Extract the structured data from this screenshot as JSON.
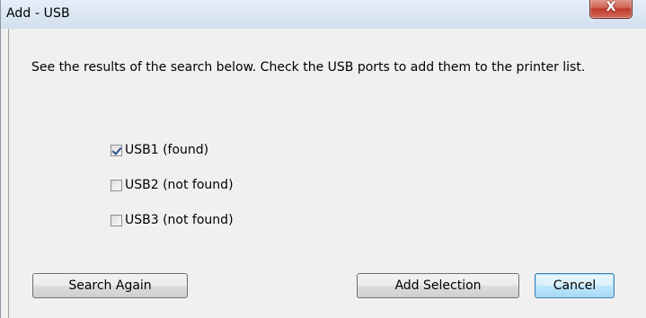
{
  "window": {
    "title": "Add  - USB",
    "close_glyph": "X"
  },
  "content": {
    "instruction": "See the results of the search below. Check the USB ports to add them to the printer list."
  },
  "ports": [
    {
      "label": "USB1 (found)",
      "checked": true
    },
    {
      "label": "USB2 (not found)",
      "checked": false
    },
    {
      "label": "USB3 (not found)",
      "checked": false
    }
  ],
  "buttons": {
    "search_again": "Search Again",
    "add_selection": "Add Selection",
    "cancel": "Cancel"
  }
}
